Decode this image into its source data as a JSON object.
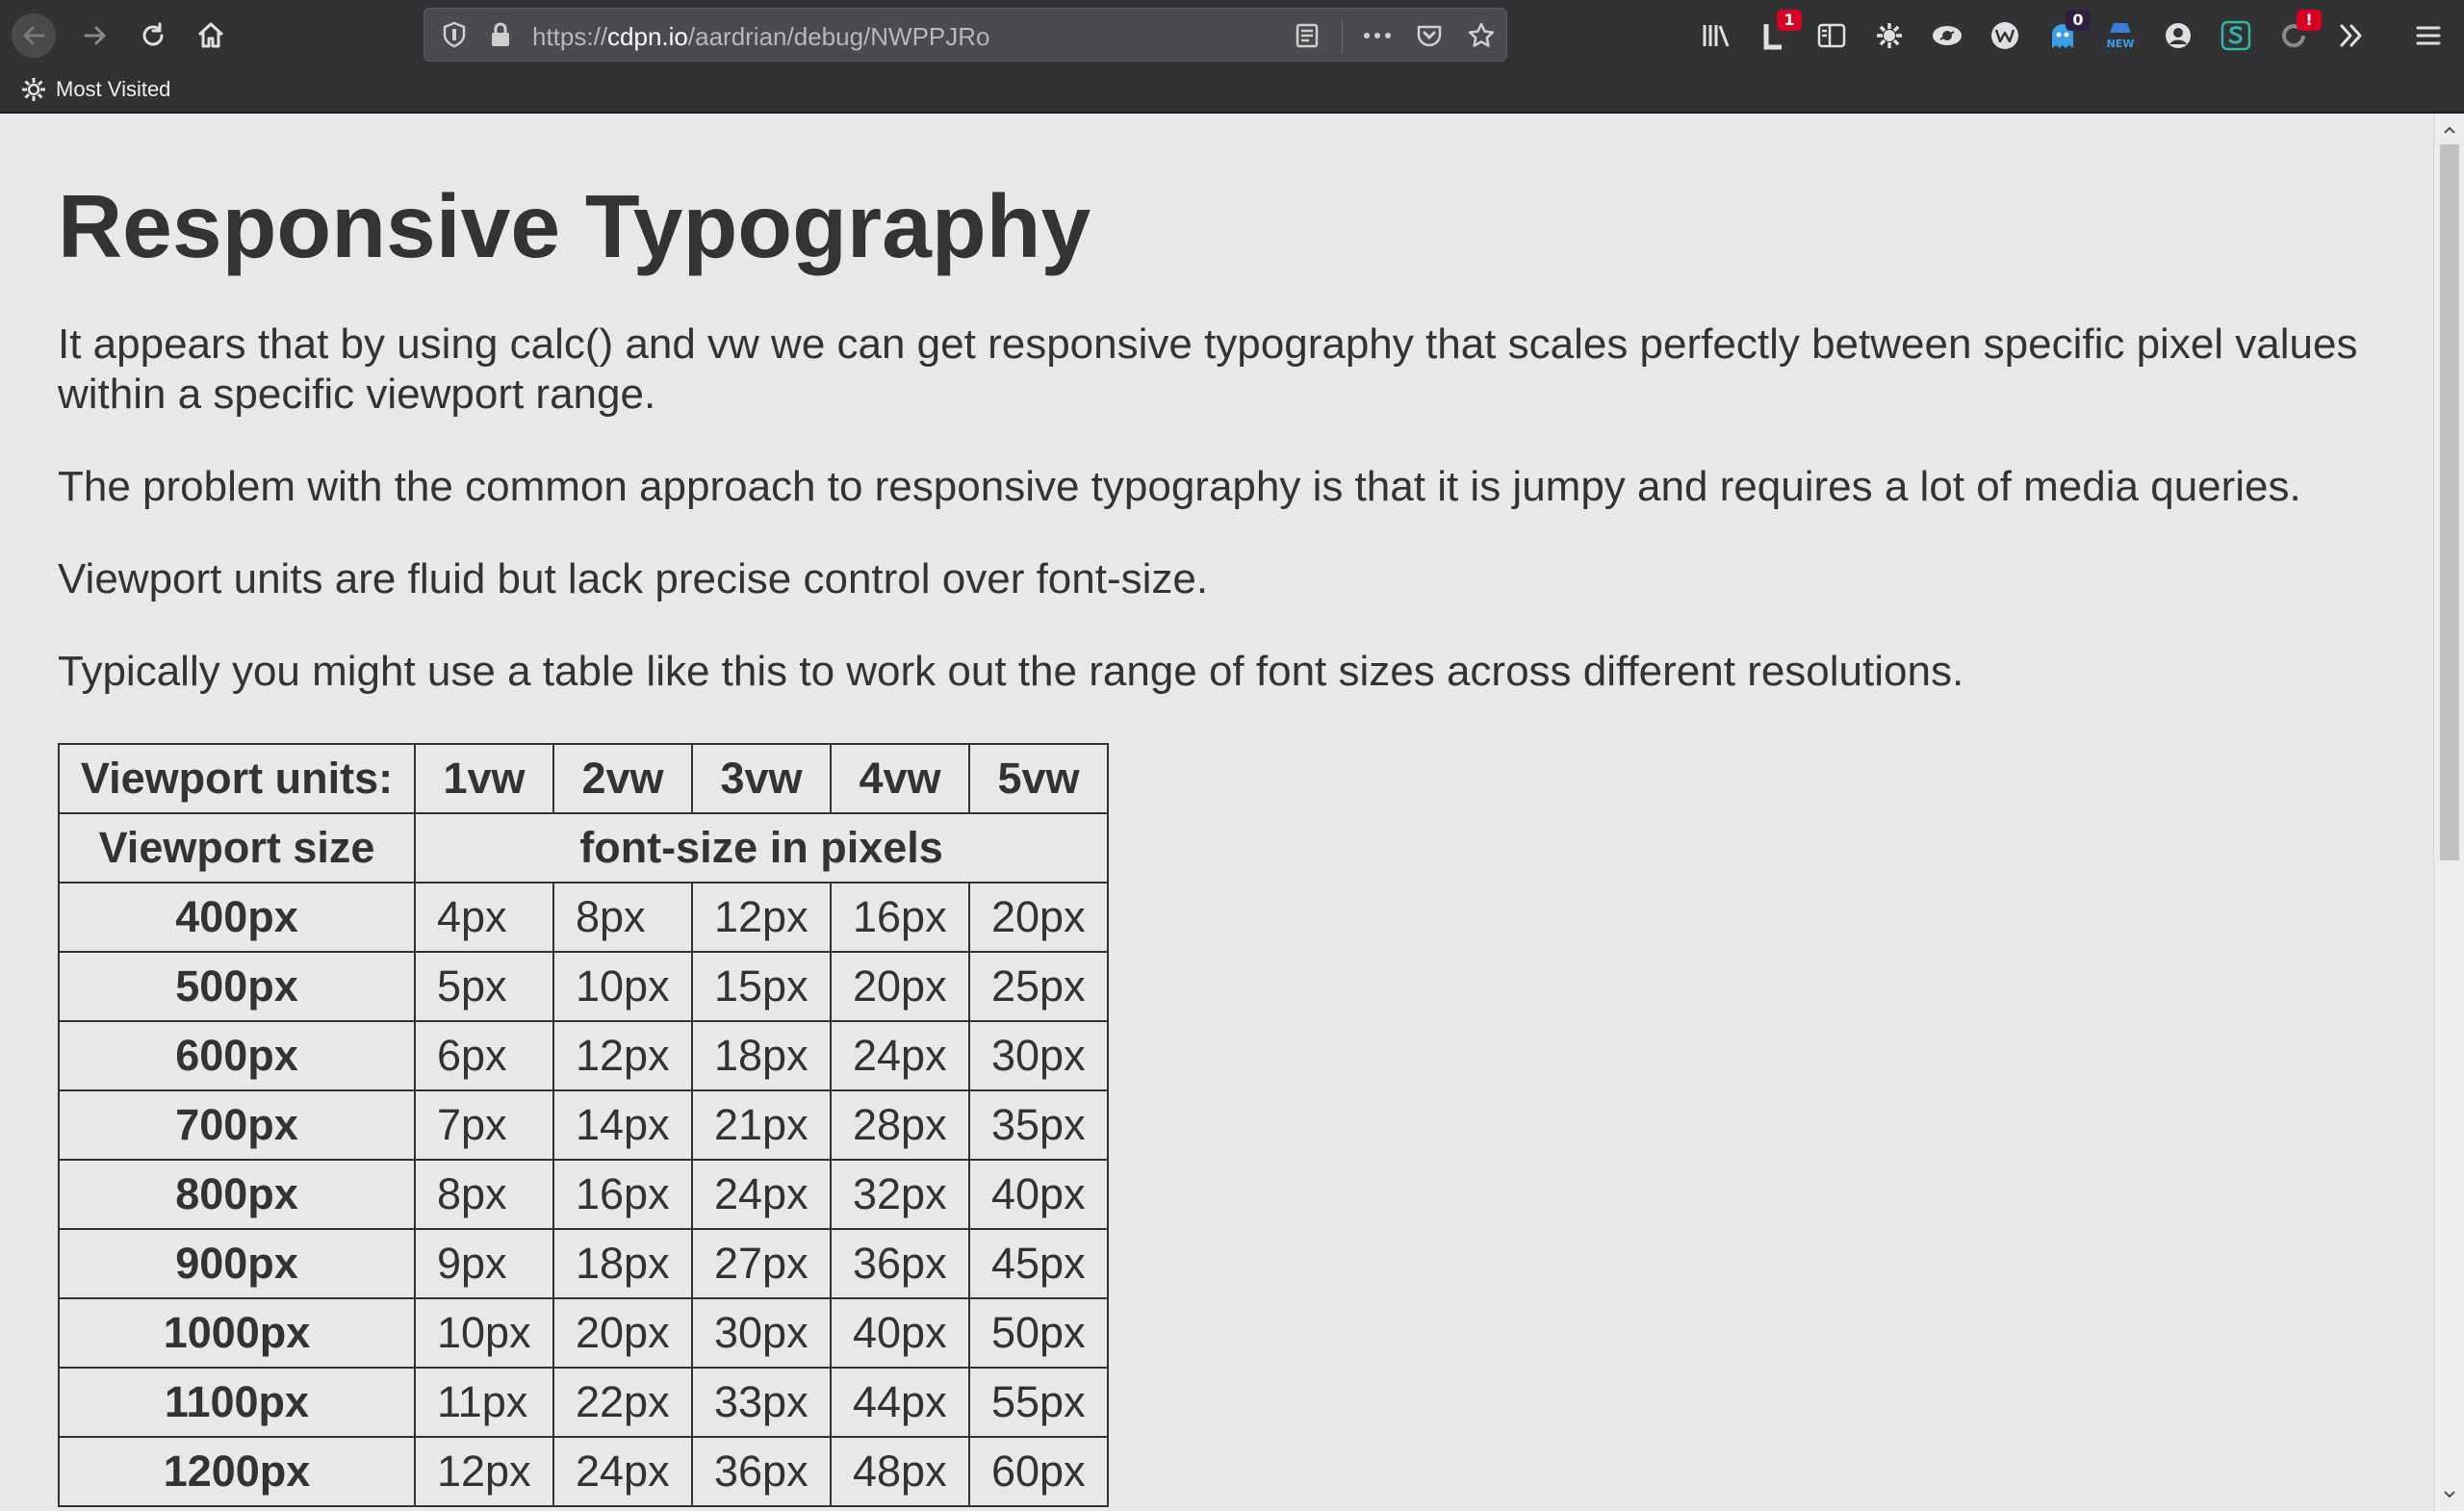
{
  "browser": {
    "url_prefix": "https://",
    "url_host": "cdpn.io",
    "url_path": "/aardrian/debug/NWPPJRo",
    "bookmark": "Most Visited",
    "extensions": [
      {
        "name": "library-icon",
        "badge": ""
      },
      {
        "name": "lastpass-icon",
        "badge": "1"
      },
      {
        "name": "sidebar-icon",
        "badge": ""
      },
      {
        "name": "settings-extension-icon",
        "badge": ""
      },
      {
        "name": "eye-extension-icon",
        "badge": ""
      },
      {
        "name": "w-extension-icon",
        "badge": ""
      },
      {
        "name": "ghost-extension-icon",
        "badge": "0"
      },
      {
        "name": "new-extension-icon",
        "badge": ""
      },
      {
        "name": "account-icon",
        "badge": ""
      },
      {
        "name": "s-extension-icon",
        "badge": ""
      },
      {
        "name": "sync-extension-icon",
        "badge": "!"
      }
    ],
    "new_label": "NEW"
  },
  "page": {
    "title": "Responsive Typography",
    "paragraphs": [
      "It appears that by using calc() and vw we can get responsive typography that scales perfectly between specific pixel values within a specific viewport range.",
      "The problem with the common approach to responsive typography is that it is jumpy and requires a lot of media queries.",
      "Viewport units are fluid but lack precise control over font-size.",
      "Typically you might use a table like this to work out the range of font sizes across different resolutions."
    ]
  },
  "table": {
    "header": [
      "Viewport units:",
      "1vw",
      "2vw",
      "3vw",
      "4vw",
      "5vw"
    ],
    "subheader": [
      "Viewport size",
      "font-size in pixels"
    ],
    "rows": [
      [
        "400px",
        "4px",
        "8px",
        "12px",
        "16px",
        "20px"
      ],
      [
        "500px",
        "5px",
        "10px",
        "15px",
        "20px",
        "25px"
      ],
      [
        "600px",
        "6px",
        "12px",
        "18px",
        "24px",
        "30px"
      ],
      [
        "700px",
        "7px",
        "14px",
        "21px",
        "28px",
        "35px"
      ],
      [
        "800px",
        "8px",
        "16px",
        "24px",
        "32px",
        "40px"
      ],
      [
        "900px",
        "9px",
        "18px",
        "27px",
        "36px",
        "45px"
      ],
      [
        "1000px",
        "10px",
        "20px",
        "30px",
        "40px",
        "50px"
      ],
      [
        "1100px",
        "11px",
        "22px",
        "33px",
        "44px",
        "55px"
      ],
      [
        "1200px",
        "12px",
        "24px",
        "36px",
        "48px",
        "60px"
      ]
    ]
  },
  "colors": {
    "chrome": "#323234",
    "page_bg": "#e8e8e8",
    "text": "#333333",
    "badge_red": "#d70022"
  }
}
